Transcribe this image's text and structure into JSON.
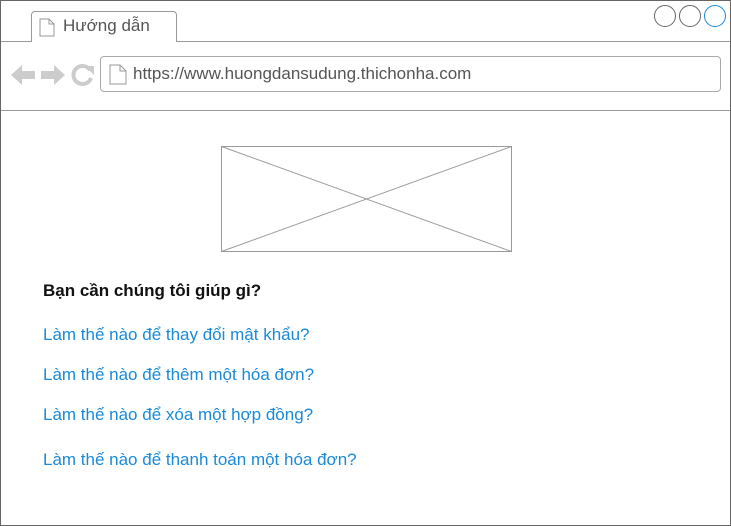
{
  "browser": {
    "tab": {
      "title": "Hướng dẫn",
      "icon": "page-icon"
    },
    "window_controls": [
      "minimize-circle-icon",
      "maximize-circle-icon",
      "close-circle-icon"
    ],
    "toolbar": {
      "back_icon": "arrow-left-icon",
      "forward_icon": "arrow-right-icon",
      "reload_icon": "reload-icon",
      "url": "https://www.huongdansudung.thichonha.com"
    }
  },
  "content": {
    "image": {
      "icon": "image-placeholder-icon"
    },
    "heading": "Bạn cần chúng tôi giúp gì?",
    "links": [
      "Làm thế nào để thay đổi mật khẩu?",
      "Làm thế nào để thêm một hóa đơn?",
      "Làm thế nào để xóa một hợp đồng?",
      "Làm thế nào để thanh toán một hóa đơn?"
    ]
  },
  "colors": {
    "link": "#1a8ad9",
    "border": "#999999",
    "icon_gray": "#cccccc",
    "active_control": "#1a8ad9"
  }
}
